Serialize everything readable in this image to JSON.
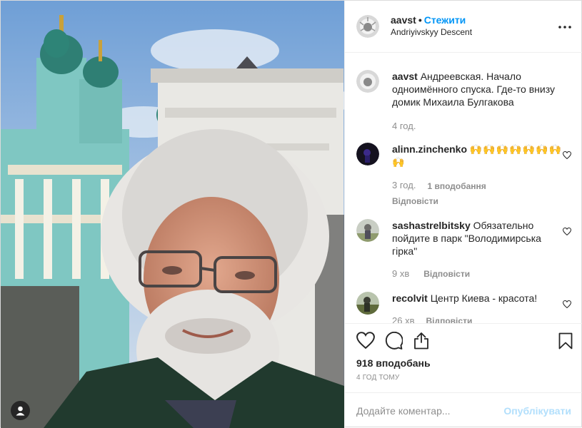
{
  "post": {
    "username": "aavst",
    "separator": "•",
    "follow_label": "Стежити",
    "location": "Andriyivskyy Descent",
    "more_icon": "more-options-icon"
  },
  "caption": {
    "username": "aavst",
    "text": "Андреевская. Начало одноимённого спуска. Где-то внизу домик Михаила Булгакова",
    "time": "4 год."
  },
  "comments": [
    {
      "username": "alinn.zinchenko",
      "text": "🙌🙌🙌🙌🙌🙌🙌🙌",
      "time": "3 год.",
      "likes": "1 вподобання",
      "reply": "Відповісти"
    },
    {
      "username": "sashastrelbitsky",
      "text": "Обязательно пойдите в парк \"Володимирська гірка\"",
      "time": "9 хв",
      "reply": "Відповісти"
    },
    {
      "username": "recolvit",
      "text": "Центр Киева - красота!",
      "time": "26 хв",
      "reply": "Відповісти"
    }
  ],
  "actions": {
    "like_icon": "heart-icon",
    "comment_icon": "comment-icon",
    "share_icon": "share-icon",
    "save_icon": "bookmark-icon",
    "likes_count": "918 вподобань",
    "time_ago": "4 ГОД ТОМУ"
  },
  "add_comment": {
    "placeholder": "Додайте коментар...",
    "publish_label": "Опублікувати"
  },
  "colors": {
    "link": "#0095f6",
    "publish_disabled": "#b2dffc",
    "secondary_text": "#8e8e8e"
  }
}
